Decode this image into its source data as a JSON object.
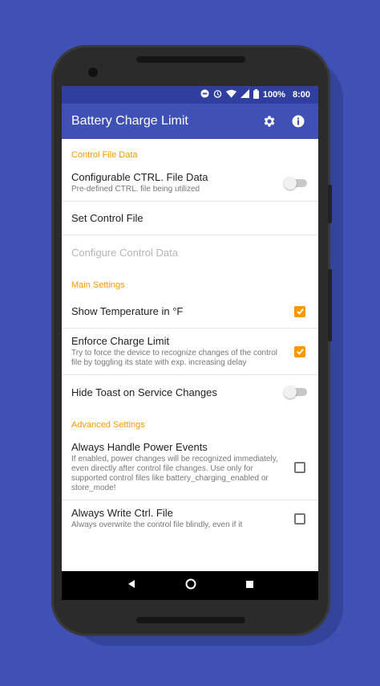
{
  "status": {
    "battery_pct": "100%",
    "time": "8:00",
    "icons": [
      "do-not-disturb-icon",
      "alarm-icon",
      "wifi-icon",
      "signal-lte-icon",
      "battery-icon"
    ]
  },
  "appbar": {
    "title": "Battery Charge Limit",
    "actions": [
      "settings-icon",
      "info-icon"
    ]
  },
  "sections": {
    "control": "Control File Data",
    "main": "Main Settings",
    "advanced": "Advanced Settings"
  },
  "prefs": {
    "configurable": {
      "title": "Configurable CTRL. File Data",
      "summary": "Pre-defined CTRL. file being utilized",
      "state": "off"
    },
    "set_control": {
      "title": "Set Control File"
    },
    "configure_control": {
      "title": "Configure Control Data",
      "enabled": false
    },
    "show_temp": {
      "title": "Show Temperature in °F",
      "checked": true
    },
    "enforce": {
      "title": "Enforce Charge Limit",
      "summary": "Try to force the device to recognize changes of the control file by toggling its state with exp. increasing delay",
      "checked": true
    },
    "hide_toast": {
      "title": "Hide Toast on Service Changes",
      "state": "off"
    },
    "power_events": {
      "title": "Always Handle Power Events",
      "summary": "If enabled, power changes will be recognized immediately, even directly after control file changes. Use only for supported control files like battery_charging_enabled or store_mode!",
      "checked": false
    },
    "write_ctrl": {
      "title": "Always Write Ctrl. File",
      "summary": "Always overwrite the control file blindly, even if it",
      "checked": false
    }
  },
  "navbar": [
    "back-icon",
    "home-icon",
    "recents-icon"
  ],
  "colors": {
    "background": "#3f51b5",
    "statusbar": "#303f9f",
    "appbar": "#3f51b5",
    "accent": "#ff9800"
  }
}
